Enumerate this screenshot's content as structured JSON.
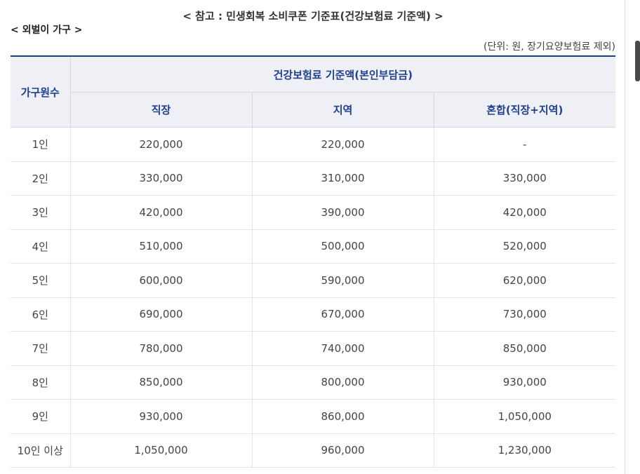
{
  "document": {
    "title": "< 참고 : 민생회복 소비쿠폰 기준표(건강보험료 기준액) >",
    "section": "< 외벌이 가구 >",
    "unit_note": "(단위: 원, 장기요양보험료 제외)"
  },
  "table": {
    "header": {
      "household_size": "가구원수",
      "group": "건강보험료 기준액(본인부담금)",
      "columns": [
        "직장",
        "지역",
        "혼합(직장+지역)"
      ]
    },
    "rows": [
      {
        "size": "1인",
        "workplace": "220,000",
        "regional": "220,000",
        "mixed": "-"
      },
      {
        "size": "2인",
        "workplace": "330,000",
        "regional": "310,000",
        "mixed": "330,000"
      },
      {
        "size": "3인",
        "workplace": "420,000",
        "regional": "390,000",
        "mixed": "420,000"
      },
      {
        "size": "4인",
        "workplace": "510,000",
        "regional": "500,000",
        "mixed": "520,000"
      },
      {
        "size": "5인",
        "workplace": "600,000",
        "regional": "590,000",
        "mixed": "620,000"
      },
      {
        "size": "6인",
        "workplace": "690,000",
        "regional": "670,000",
        "mixed": "730,000"
      },
      {
        "size": "7인",
        "workplace": "780,000",
        "regional": "740,000",
        "mixed": "850,000"
      },
      {
        "size": "8인",
        "workplace": "850,000",
        "regional": "800,000",
        "mixed": "930,000"
      },
      {
        "size": "9인",
        "workplace": "930,000",
        "regional": "860,000",
        "mixed": "1,050,000"
      },
      {
        "size": "10인 이상",
        "workplace": "1,050,000",
        "regional": "960,000",
        "mixed": "1,230,000"
      }
    ]
  }
}
